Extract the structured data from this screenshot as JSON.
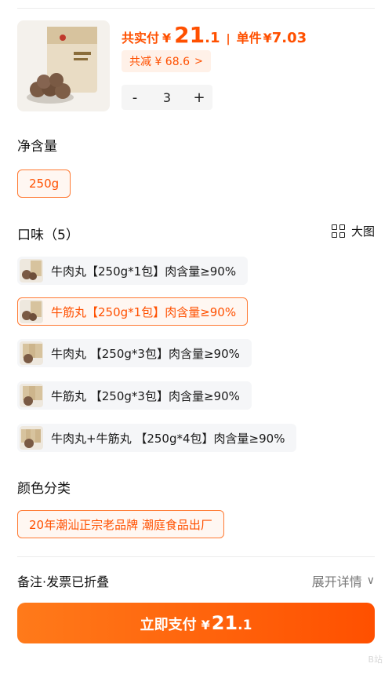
{
  "summary": {
    "total_label": "共实付",
    "currency": "¥",
    "total_int": "21",
    "total_dec": ".1",
    "separator": "|",
    "unit_label": "单件",
    "unit_currency": "¥",
    "unit_value": "7.03",
    "discount_text": "共减 ¥ 68.6",
    "discount_chevron": ">",
    "minus": "-",
    "quantity": "3",
    "plus": "+"
  },
  "net_content": {
    "title": "净含量",
    "options": [
      "250g"
    ]
  },
  "flavor": {
    "title": "口味（5）",
    "view_toggle": "大图",
    "options": [
      {
        "label": "牛肉丸【250g*1包】肉含量≥90%",
        "selected": false
      },
      {
        "label": "牛筋丸【250g*1包】肉含量≥90%",
        "selected": true
      },
      {
        "label": "牛肉丸 【250g*3包】肉含量≥90%",
        "selected": false
      },
      {
        "label": "牛筋丸 【250g*3包】肉含量≥90%",
        "selected": false
      },
      {
        "label": "牛肉丸+牛筋丸 【250g*4包】肉含量≥90%",
        "selected": false
      }
    ]
  },
  "color_category": {
    "title": "颜色分类",
    "options": [
      "20年潮汕正宗老品牌 潮庭食品出厂"
    ]
  },
  "notes": {
    "label": "备注·发票已折叠",
    "expand_label": "展开详情",
    "expand_chevron": "∨"
  },
  "pay": {
    "label": "立即支付",
    "currency": "¥",
    "amount_int": "21",
    "amount_dec": ".1"
  },
  "watermark": "B站",
  "colors": {
    "accent": "#ff5000",
    "accent_light": "#fff1e8",
    "chip_bg": "#f5f6f8"
  }
}
